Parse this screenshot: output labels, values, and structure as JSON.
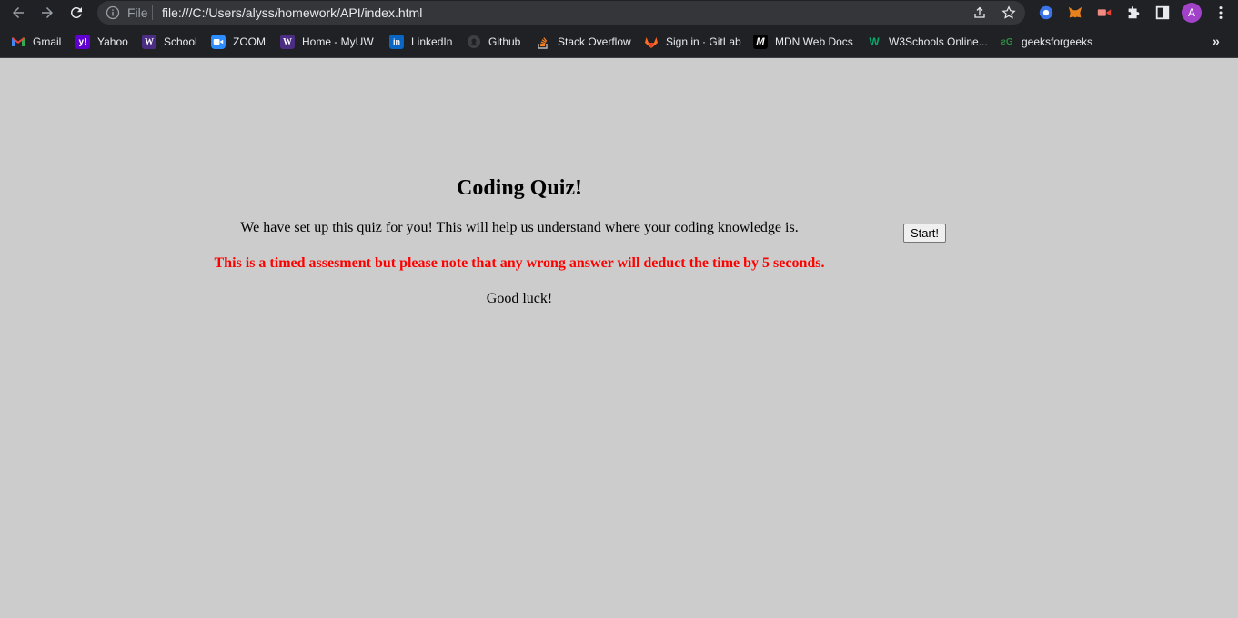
{
  "browser": {
    "omnibox": {
      "scheme": "File",
      "url": "file:///C:/Users/alyss/homework/API/index.html"
    },
    "profile_initial": "A",
    "bookmarks": [
      {
        "label": "Gmail",
        "icon": "gmail-icon"
      },
      {
        "label": "Yahoo",
        "icon": "yahoo-icon"
      },
      {
        "label": "School",
        "icon": "uw-icon"
      },
      {
        "label": "ZOOM",
        "icon": "zoom-icon"
      },
      {
        "label": "Home - MyUW",
        "icon": "uw-icon"
      },
      {
        "label": "LinkedIn",
        "icon": "linkedin-icon"
      },
      {
        "label": "Github",
        "icon": "github-icon"
      },
      {
        "label": "Stack Overflow",
        "icon": "stackoverflow-icon"
      },
      {
        "label": "Sign in · GitLab",
        "icon": "gitlab-icon"
      },
      {
        "label": "MDN Web Docs",
        "icon": "mdn-icon"
      },
      {
        "label": "W3Schools Online...",
        "icon": "w3schools-icon"
      },
      {
        "label": "geeksforgeeks",
        "icon": "gfg-icon"
      }
    ],
    "more_label": "»"
  },
  "page": {
    "title": "Coding Quiz!",
    "intro": "We have set up this quiz for you! This will help us understand where your coding knowledge is.",
    "warning": "This is a timed assesment but please note that any wrong answer will deduct the time by 5 seconds.",
    "luck": "Good luck!",
    "start_label": "Start!"
  },
  "colors": {
    "page_background": "#cccccc",
    "warning": "#ff0000",
    "chrome_background": "#202124"
  }
}
